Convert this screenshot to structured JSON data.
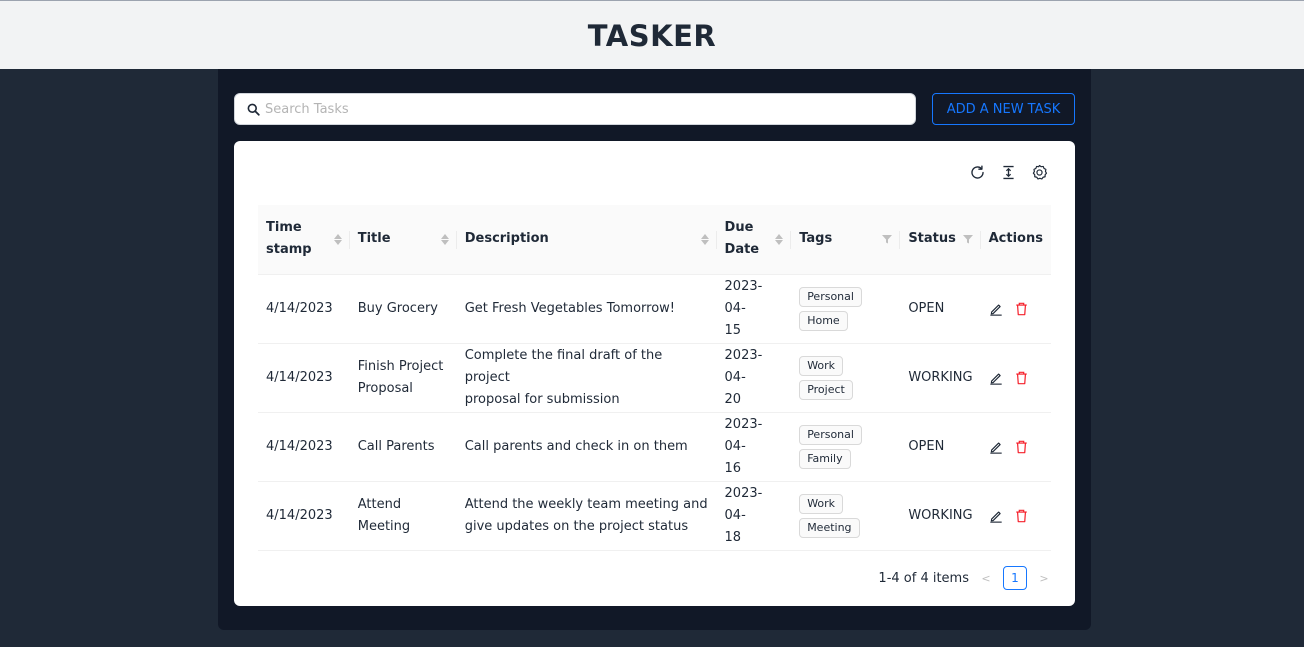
{
  "app": {
    "title": "TASKER"
  },
  "search": {
    "placeholder": "Search Tasks",
    "value": ""
  },
  "add_button": {
    "label": "ADD A NEW TASK"
  },
  "toolbar": {
    "icons": [
      "reload-icon",
      "column-height-icon",
      "settings-icon"
    ]
  },
  "table": {
    "columns": {
      "timestamp_l1": "Time",
      "timestamp_l2": "stamp",
      "title": "Title",
      "description": "Description",
      "due_l1": "Due",
      "due_l2": "Date",
      "tags": "Tags",
      "status": "Status",
      "actions": "Actions"
    },
    "rows": [
      {
        "timestamp": "4/14/2023",
        "title_l1": "Buy Grocery",
        "title_l2": "",
        "desc_l1": "Get Fresh Vegetables Tomorrow!",
        "desc_l2": "",
        "due_l1": "2023-04-",
        "due_l2": "15",
        "tag1": "Personal",
        "tag2": "Home",
        "status": "OPEN"
      },
      {
        "timestamp": "4/14/2023",
        "title_l1": "Finish Project",
        "title_l2": "Proposal",
        "desc_l1": "Complete the final draft of the project",
        "desc_l2": "proposal for submission",
        "due_l1": "2023-04-",
        "due_l2": "20",
        "tag1": "Work",
        "tag2": "Project",
        "status": "WORKING"
      },
      {
        "timestamp": "4/14/2023",
        "title_l1": "Call Parents",
        "title_l2": "",
        "desc_l1": "Call parents and check in on them",
        "desc_l2": "",
        "due_l1": "2023-04-",
        "due_l2": "16",
        "tag1": "Personal",
        "tag2": "Family",
        "status": "OPEN"
      },
      {
        "timestamp": "4/14/2023",
        "title_l1": "Attend",
        "title_l2": "Meeting",
        "desc_l1": "Attend the weekly team meeting and",
        "desc_l2": "give updates on the project status",
        "due_l1": "2023-04-",
        "due_l2": "18",
        "tag1": "Work",
        "tag2": "Meeting",
        "status": "WORKING"
      }
    ]
  },
  "pagination": {
    "summary": "1-4 of 4 items",
    "current_page": "1",
    "prev": "<",
    "next": ">"
  },
  "colors": {
    "accent": "#1677ff",
    "danger": "#f5222d",
    "background": "#1f2937",
    "panel": "#111827"
  }
}
